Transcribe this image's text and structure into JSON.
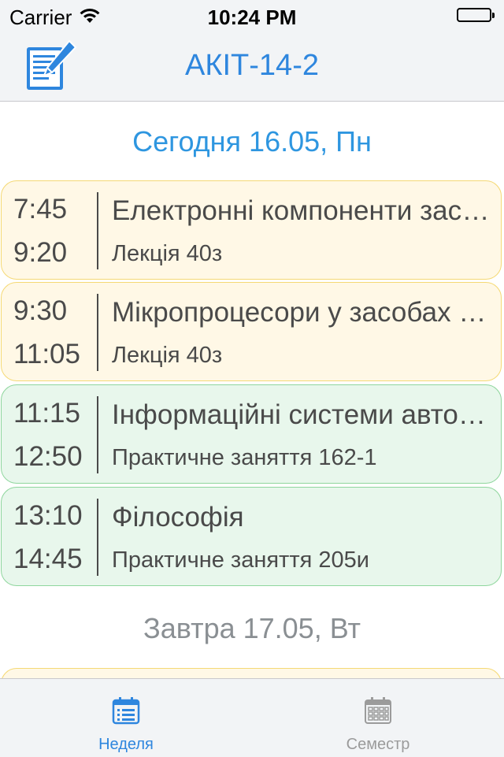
{
  "status_bar": {
    "carrier": "Carrier",
    "time": "10:24 PM"
  },
  "nav": {
    "title": "АКІТ-14-2",
    "edit_icon": "edit-note-icon",
    "accent_color": "#2e86de"
  },
  "today": {
    "header": "Сегодня 16.05, Пн",
    "lessons": [
      {
        "start": "7:45",
        "end": "9:20",
        "subject": "Електронні компоненти засобів автоматизації",
        "detail": "Лекція 40з",
        "kind": "lecture"
      },
      {
        "start": "9:30",
        "end": "11:05",
        "subject": "Мікропроцесори у засобах автоматизації",
        "detail": "Лекція 40з",
        "kind": "lecture"
      },
      {
        "start": "11:15",
        "end": "12:50",
        "subject": "Інформаційні системи автоматизації",
        "detail": "Практичне заняття 162-1",
        "kind": "practice"
      },
      {
        "start": "13:10",
        "end": "14:45",
        "subject": "Філософія",
        "detail": "Практичне заняття 205и",
        "kind": "practice"
      }
    ]
  },
  "tomorrow": {
    "header": "Завтра 17.05, Вт"
  },
  "tabs": [
    {
      "label": "Неделя",
      "icon": "list-calendar-icon",
      "active": true
    },
    {
      "label": "Семестр",
      "icon": "grid-calendar-icon",
      "active": false
    }
  ],
  "colors": {
    "lecture_bg": "#fff8e6",
    "lecture_border": "#f5d975",
    "practice_bg": "#e8f7ec",
    "practice_border": "#8fd69d",
    "today_header": "#2e96e0",
    "tomorrow_header": "#8a8f93"
  }
}
